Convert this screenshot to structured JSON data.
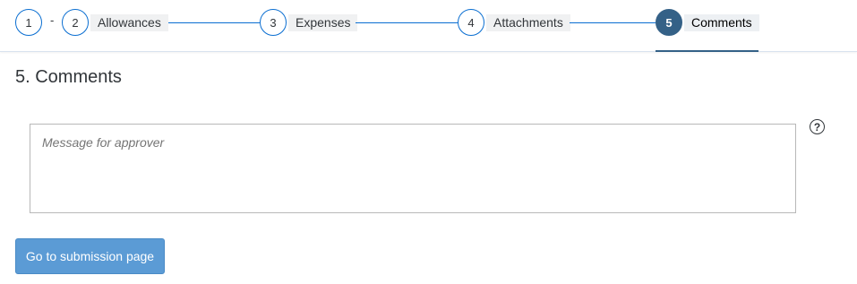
{
  "wizard": {
    "steps": [
      {
        "number": "1",
        "label": ""
      },
      {
        "number": "2",
        "label": "Allowances"
      },
      {
        "number": "3",
        "label": "Expenses"
      },
      {
        "number": "4",
        "label": "Attachments"
      },
      {
        "number": "5",
        "label": "Comments",
        "active": true
      }
    ],
    "separator": "-"
  },
  "section": {
    "title": "5. Comments"
  },
  "comment": {
    "placeholder": "Message for approver",
    "value": ""
  },
  "help": {
    "icon": "question-circle-icon",
    "glyph": "?"
  },
  "actions": {
    "submit_label": "Go to submission page"
  },
  "colors": {
    "accent": "#0a6ed1",
    "active_step": "#346187",
    "button": "#5b9bd5"
  }
}
